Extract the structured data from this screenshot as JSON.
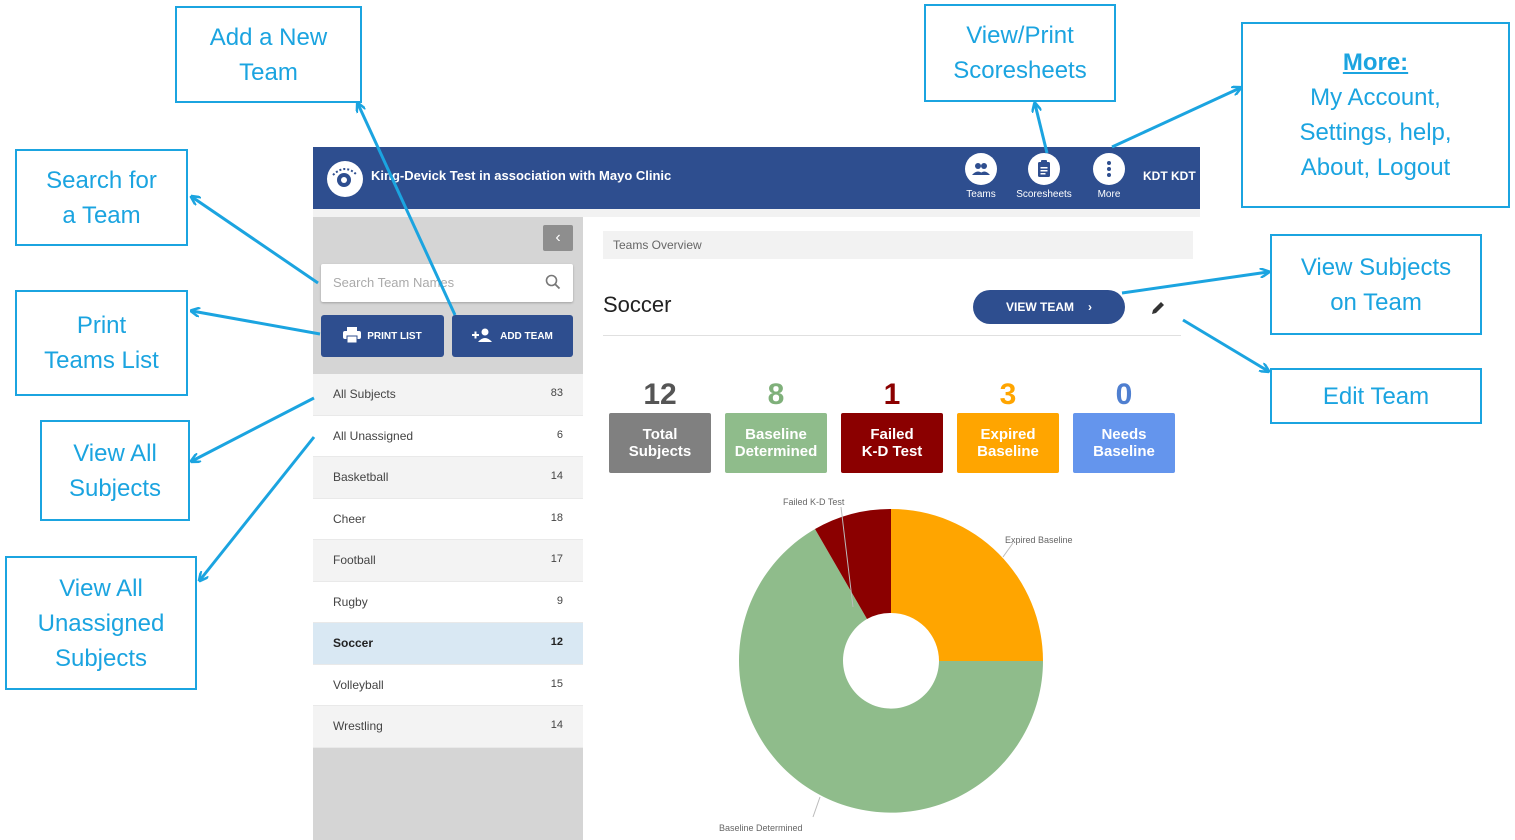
{
  "app": {
    "title": "King-Devick Test in association with Mayo Clinic",
    "nav": [
      {
        "label": "Teams",
        "icon": "people-icon"
      },
      {
        "label": "Scoresheets",
        "icon": "clipboard-icon"
      },
      {
        "label": "More",
        "icon": "more-vert-icon"
      }
    ],
    "user": "KDT KDT",
    "brand_color": "#2e4e8f"
  },
  "sidebar": {
    "collapse_icon": "chevron-left-icon",
    "search_placeholder": "Search Team Names",
    "print_label": "PRINT LIST",
    "add_label": "ADD TEAM",
    "items": [
      {
        "name": "All Subjects",
        "count": "83"
      },
      {
        "name": "All Unassigned",
        "count": "6"
      },
      {
        "name": "Basketball",
        "count": "14"
      },
      {
        "name": "Cheer",
        "count": "18"
      },
      {
        "name": "Football",
        "count": "17"
      },
      {
        "name": "Rugby",
        "count": "9"
      },
      {
        "name": "Soccer",
        "count": "12"
      },
      {
        "name": "Volleyball",
        "count": "15"
      },
      {
        "name": "Wrestling",
        "count": "14"
      }
    ],
    "selected": "Soccer"
  },
  "main": {
    "breadcrumb": "Teams Overview",
    "team_name": "Soccer",
    "view_team_label": "VIEW TEAM",
    "stats": [
      {
        "value": "12",
        "label_1": "Total",
        "label_2": "Subjects",
        "color": "#808080"
      },
      {
        "value": "8",
        "label_1": "Baseline",
        "label_2": "Determined",
        "color": "#8fbc8b"
      },
      {
        "value": "1",
        "label_1": "Failed",
        "label_2": "K-D Test",
        "color": "#8b0000"
      },
      {
        "value": "3",
        "label_1": "Expired",
        "label_2": "Baseline",
        "color": "#ffa500"
      },
      {
        "value": "0",
        "label_1": "Needs",
        "label_2": "Baseline",
        "color": "#6495ed"
      }
    ],
    "chart_labels": {
      "failed": "Failed K-D Test",
      "expired": "Expired Baseline",
      "baseline": "Baseline Determined"
    }
  },
  "annotations": {
    "add_team": [
      "Add a New",
      "Team"
    ],
    "search": [
      "Search for",
      "a Team"
    ],
    "print": [
      "Print",
      "Teams List"
    ],
    "view_all": [
      "View All",
      "Subjects"
    ],
    "view_unassigned": [
      "View All",
      "Unassigned",
      "Subjects"
    ],
    "scoresheets": [
      "View/Print",
      "Scoresheets"
    ],
    "more_title": "More:",
    "more_lines": [
      "My Account,",
      "Settings, help,",
      "About, Logout"
    ],
    "view_subjects": [
      "View Subjects",
      "on Team"
    ],
    "edit_team": "Edit Team",
    "color": "#1ba4e0"
  }
}
